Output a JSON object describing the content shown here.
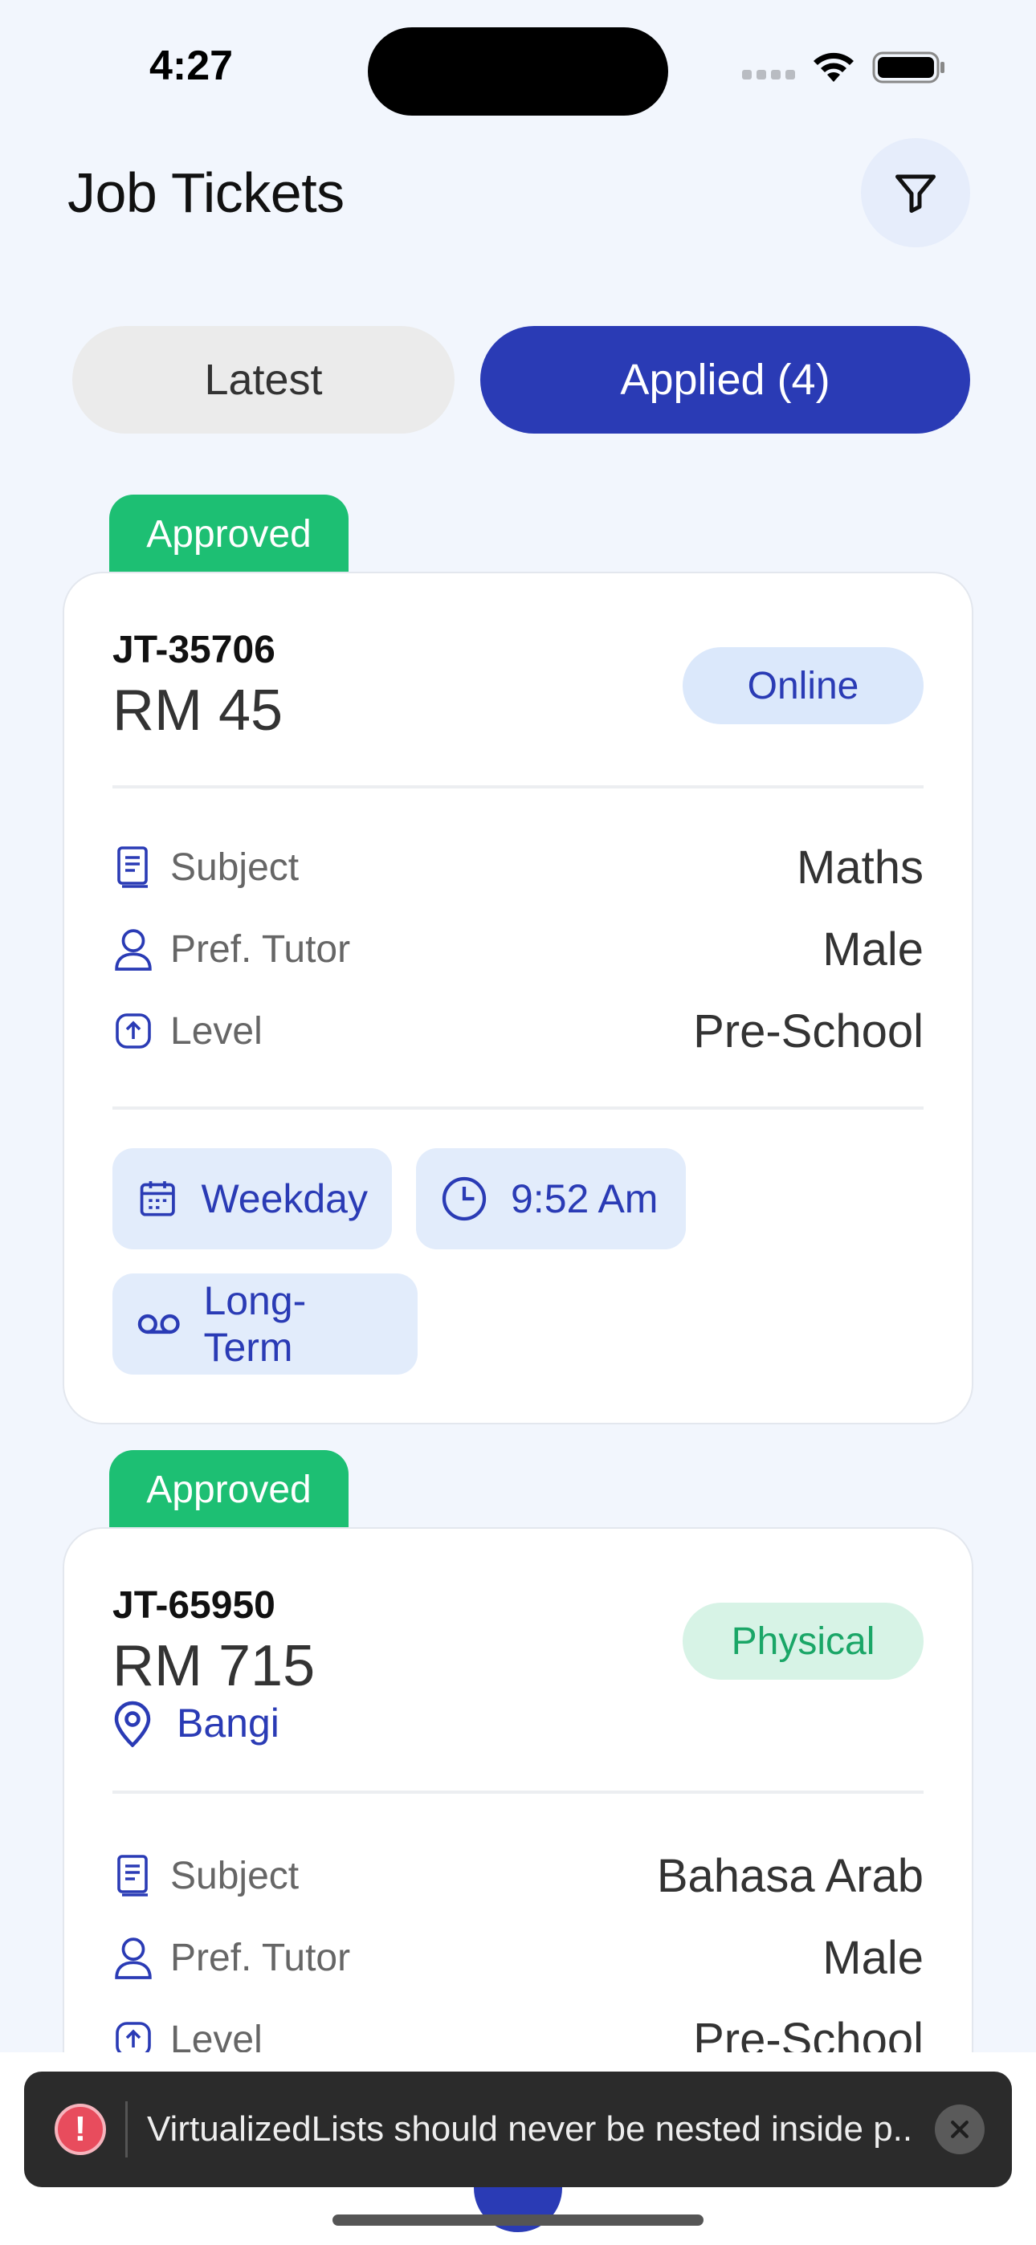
{
  "status_bar": {
    "time": "4:27"
  },
  "header": {
    "title": "Job Tickets"
  },
  "tabs": [
    {
      "label": "Latest",
      "active": false
    },
    {
      "label": "Applied (4)",
      "active": true
    }
  ],
  "tickets": [
    {
      "status": "Approved",
      "id": "JT-35706",
      "rate": "RM 45",
      "mode": "Online",
      "rows": [
        {
          "label": "Subject",
          "value": "Maths",
          "icon": "book-icon"
        },
        {
          "label": "Pref. Tutor",
          "value": "Male",
          "icon": "user-icon"
        },
        {
          "label": "Level",
          "value": "Pre-School",
          "icon": "level-up-icon"
        }
      ],
      "chips": [
        {
          "label": "Weekday",
          "icon": "calendar-icon"
        },
        {
          "label": "9:52 Am",
          "icon": "clock-icon"
        },
        {
          "label": "Long-Term",
          "icon": "voicemail-icon"
        }
      ]
    },
    {
      "status": "Approved",
      "id": "JT-65950",
      "rate": "RM 715",
      "mode": "Physical",
      "location": "Bangi",
      "rows": [
        {
          "label": "Subject",
          "value": "Bahasa Arab",
          "icon": "book-icon"
        },
        {
          "label": "Pref. Tutor",
          "value": "Male",
          "icon": "user-icon"
        },
        {
          "label": "Level",
          "value": "Pre-School",
          "icon": "level-up-icon"
        }
      ]
    }
  ],
  "toast": {
    "message": "VirtualizedLists should never be nested inside p..."
  },
  "colors": {
    "primary": "#2a3bb5",
    "approved": "#1dbf73",
    "background": "#f2f6fd"
  }
}
